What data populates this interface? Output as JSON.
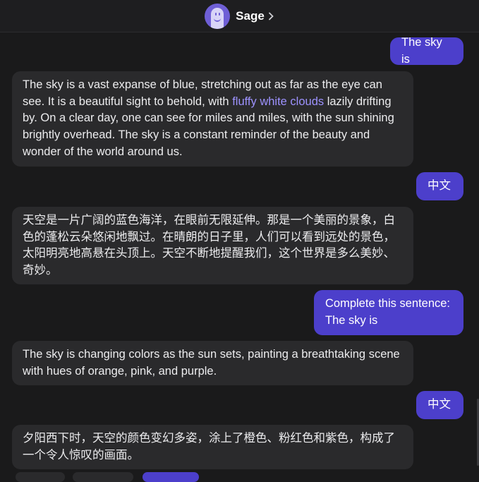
{
  "header": {
    "bot_name": "Sage",
    "avatar_icon": "ghost-avatar-icon",
    "chevron_icon": "chevron-right-icon"
  },
  "colors": {
    "background": "#1a1a1b",
    "user_bubble": "#4c3fcb",
    "bot_bubble": "#2a2a2c",
    "link": "#9d92ff"
  },
  "messages": [
    {
      "role": "user",
      "text": "The sky is"
    },
    {
      "role": "bot",
      "text_before": "The sky is a vast expanse of blue, stretching out as far as the eye can see. It is a beautiful sight to behold, with ",
      "link_text": "fluffy white clouds",
      "text_after": " lazily drifting by. On a clear day, one can see for miles and miles, with the sun shining brightly overhead. The sky is a constant reminder of the beauty and wonder of the world around us."
    },
    {
      "role": "user",
      "text": "中文"
    },
    {
      "role": "bot",
      "text": "天空是一片广阔的蓝色海洋，在眼前无限延伸。那是一个美丽的景象，白色的蓬松云朵悠闲地飘过。在晴朗的日子里，人们可以看到远处的景色，太阳明亮地高悬在头顶上。天空不断地提醒我们，这个世界是多么美妙、奇妙。"
    },
    {
      "role": "user",
      "text": "Complete this sentence: The sky is"
    },
    {
      "role": "bot",
      "text": "The sky is changing colors as the sun sets, painting a breathtaking scene with hues of orange, pink, and purple."
    },
    {
      "role": "user",
      "text": "中文"
    },
    {
      "role": "bot",
      "text": "夕阳西下时，天空的颜色变幻多姿，涂上了橙色、粉红色和紫色，构成了一个令人惊叹的画面。"
    }
  ]
}
